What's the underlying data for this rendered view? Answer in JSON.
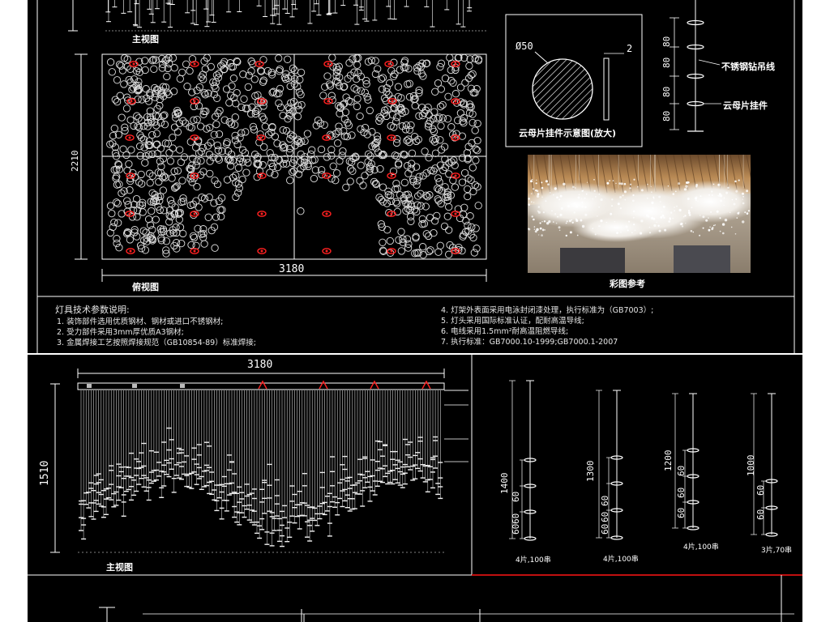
{
  "top_sheet": {
    "front_view_label": "主视图",
    "top_view_label": "俯视图",
    "top_view_width": "3180",
    "top_view_depth": "2210",
    "detail": {
      "diameter": "Ø50",
      "thickness": "2",
      "caption": "云母片挂件示意图(放大)"
    },
    "hang_detail": {
      "spacings": [
        "80",
        "80",
        "80",
        "80"
      ],
      "wire_label": "不锈钢钻吊线",
      "pendant_label": "云母片挂件"
    },
    "photo_caption": "彩图参考",
    "notes_title": "灯具技术参数说明:",
    "notes_left": [
      "1. 装饰部件选用优质钢材、钢材或进口不锈钢材;",
      "2. 受力部件采用3mm厚优质A3钢材;",
      "3. 金属焊接工艺按照焊接规范（GB10854-89）标准焊接;"
    ],
    "notes_right": [
      "4. 灯架外表面采用电泳封闭漆处理，执行标准为（GB7003）;",
      "5. 灯头采用国际标准认证，配耐高温导线;",
      "6. 电线采用1.5mm²耐高温阻燃导线;",
      "7. 执行标准：GB7000.10-1999;GB7000.1-2007"
    ]
  },
  "bottom_sheet": {
    "front_width": "3180",
    "front_height": "1510",
    "front_view_label": "主视图",
    "strings": [
      {
        "length": "1400",
        "spacings": [
          "60",
          "60",
          "60"
        ],
        "note": "4片,100串"
      },
      {
        "length": "1300",
        "spacings": [
          "60",
          "60",
          "60"
        ],
        "note": "4片,100串"
      },
      {
        "length": "1200",
        "spacings": [
          "60",
          "60",
          "60"
        ],
        "note": "4片,100串"
      },
      {
        "length": "1000",
        "spacings": [
          "60",
          "60"
        ],
        "note": "3片,70串"
      }
    ]
  },
  "colors": {
    "background": "#000000",
    "lines": "#ffffff",
    "accent": "#ff2020",
    "page_bg": "#ffffff"
  }
}
